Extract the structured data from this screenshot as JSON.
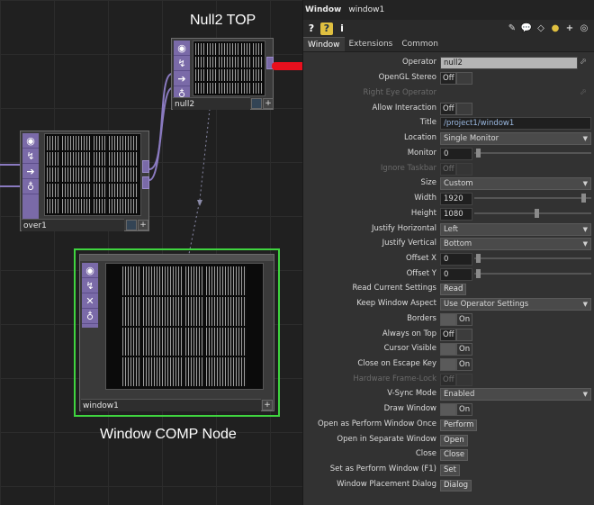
{
  "annotations": {
    "null2_label": "Null2 TOP",
    "window_comp_label": "Window COMP Node"
  },
  "nodes": {
    "null2": {
      "name": "null2"
    },
    "over1": {
      "name": "over1"
    },
    "window1": {
      "name": "window1"
    }
  },
  "panel": {
    "type": "Window",
    "name": "window1",
    "tabs": [
      "Window",
      "Extensions",
      "Common"
    ],
    "active_tab": "Window",
    "toolbar": {
      "help": "?",
      "python_help": "?",
      "info": "i"
    }
  },
  "params": {
    "operator": {
      "label": "Operator",
      "value": "null2"
    },
    "opengl_stereo": {
      "label": "OpenGL Stereo",
      "value": "Off"
    },
    "right_eye_operator": {
      "label": "Right Eye Operator"
    },
    "allow_interaction": {
      "label": "Allow Interaction",
      "value": "Off"
    },
    "title": {
      "label": "Title",
      "value": "/project1/window1"
    },
    "location": {
      "label": "Location",
      "value": "Single Monitor"
    },
    "monitor": {
      "label": "Monitor",
      "value": "0"
    },
    "ignore_taskbar": {
      "label": "Ignore Taskbar",
      "value": "Off"
    },
    "size": {
      "label": "Size",
      "value": "Custom"
    },
    "width": {
      "label": "Width",
      "value": "1920"
    },
    "height": {
      "label": "Height",
      "value": "1080"
    },
    "justify_horizontal": {
      "label": "Justify Horizontal",
      "value": "Left"
    },
    "justify_vertical": {
      "label": "Justify Vertical",
      "value": "Bottom"
    },
    "offset_x": {
      "label": "Offset X",
      "value": "0"
    },
    "offset_y": {
      "label": "Offset Y",
      "value": "0"
    },
    "read_current_settings": {
      "label": "Read Current Settings",
      "button": "Read"
    },
    "keep_window_aspect": {
      "label": "Keep Window Aspect",
      "value": "Use Operator Settings"
    },
    "borders": {
      "label": "Borders",
      "value": "On"
    },
    "always_on_top": {
      "label": "Always on Top",
      "value": "Off"
    },
    "cursor_visible": {
      "label": "Cursor Visible",
      "value": "On"
    },
    "close_on_escape": {
      "label": "Close on Escape Key",
      "value": "On"
    },
    "hardware_frame_lock": {
      "label": "Hardware Frame-Lock",
      "value": "Off"
    },
    "vsync_mode": {
      "label": "V-Sync Mode",
      "value": "Enabled"
    },
    "draw_window": {
      "label": "Draw Window",
      "value": "On"
    },
    "open_as_perform": {
      "label": "Open as Perform Window Once",
      "button": "Perform"
    },
    "open_separate": {
      "label": "Open in Separate Window",
      "button": "Open"
    },
    "close": {
      "label": "Close",
      "button": "Close"
    },
    "set_as_perform": {
      "label": "Set as Perform Window (F1)",
      "button": "Set"
    },
    "placement_dialog": {
      "label": "Window Placement Dialog",
      "button": "Dialog"
    }
  },
  "colors": {
    "node_side": "#7a6aa8",
    "selection_green": "#3fd43f",
    "red_arrow": "#e8101e"
  }
}
